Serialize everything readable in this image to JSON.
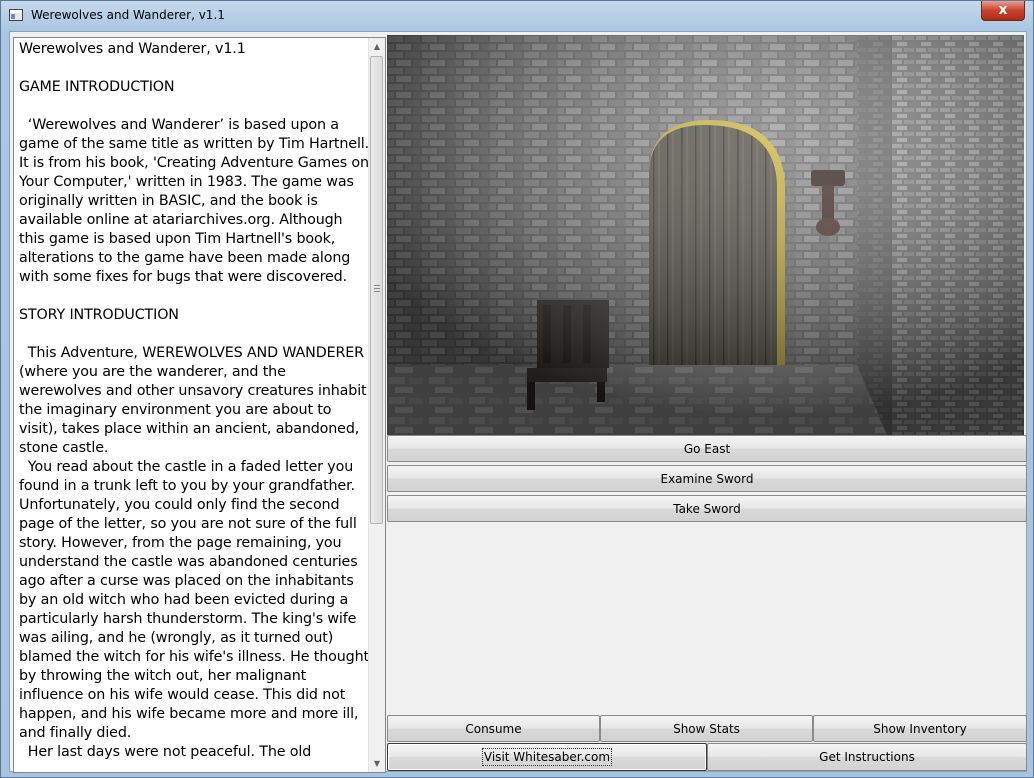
{
  "window": {
    "title": "Werewolves and Wanderer, v1.1",
    "close_glyph": "x"
  },
  "text_pane": {
    "content": "Werewolves and Wanderer, v1.1\n\nGAME INTRODUCTION\n\n  ‘Werewolves and Wanderer’ is based upon a game of the same title as written by Tim Hartnell. It is from his book, 'Creating Adventure Games on Your Computer,' written in 1983. The game was originally written in BASIC, and the book is available online at atariarchives.org. Although this game is based upon Tim Hartnell's book, alterations to the game have been made along with some fixes for bugs that were discovered.\n\nSTORY INTRODUCTION\n\n  This Adventure, WEREWOLVES AND WANDERER (where you are the wanderer, and the werewolves and other unsavory creatures inhabit the imaginary environment you are about to visit), takes place within an ancient, abandoned, stone castle.\n  You read about the castle in a faded letter you found in a trunk left to you by your grandfather. Unfortunately, you could only find the second page of the letter, so you are not sure of the full story. However, from the page remaining, you understand the castle was abandoned centuries ago after a curse was placed on the inhabitants by an old witch who had been evicted during a particularly harsh thunderstorm. The king's wife was ailing, and he (wrongly, as it turned out) blamed the witch for his wife's illness. He thought by throwing the witch out, her malignant influence on his wife would cease. This did not happen, and his wife became more and more ill, and finally died.\n  Her last days were not peaceful. The old"
  },
  "actions": [
    {
      "label": "Go East"
    },
    {
      "label": "Examine Sword"
    },
    {
      "label": "Take Sword"
    }
  ],
  "bottom_row1": {
    "consume": "Consume",
    "show_stats": "Show Stats",
    "show_inventory": "Show Inventory"
  },
  "bottom_row2": {
    "visit_site": "Visit Whitesaber.com",
    "get_instructions": "Get Instructions"
  },
  "colors": {
    "title_bar": "#a9c6e2",
    "client_bg": "#f0f0f0",
    "close_button": "#c7412c"
  }
}
